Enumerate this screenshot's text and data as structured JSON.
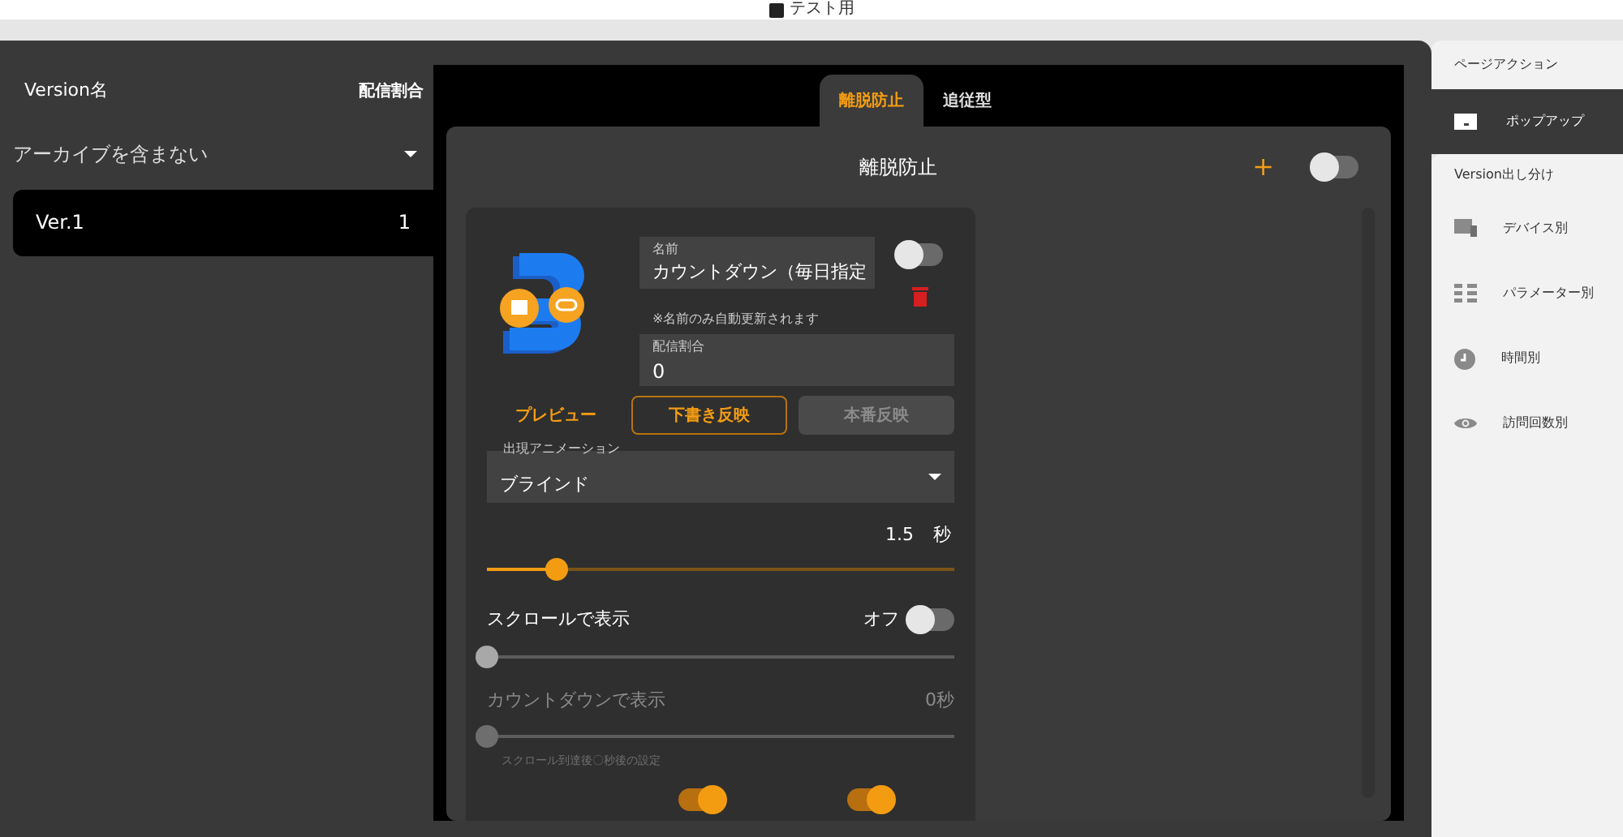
{
  "header": {
    "label": "テスト用"
  },
  "versions": {
    "col_name": "Version名",
    "col_ratio": "配信割合",
    "filter": "アーカイブを含まない",
    "items": [
      {
        "name": "Ver.1",
        "ratio": "1",
        "selected": true
      }
    ]
  },
  "tabs": [
    {
      "label": "離脱防止",
      "selected": true
    },
    {
      "label": "追従型",
      "selected": false
    }
  ],
  "panel": {
    "title": "離脱防止",
    "add": "+",
    "on": false
  },
  "item": {
    "name_label": "名前",
    "name_value": "カウントダウン（毎日指定",
    "on": false,
    "note": "※名前のみ自動更新されます",
    "ratio_label": "配信割合",
    "ratio_value": "0",
    "preview": "プレビュー",
    "draft": "下書き反映",
    "publish": {
      "label": "本番反映",
      "disabled": true
    },
    "animation_label": "出現アニメーション",
    "animation_value": "ブラインド",
    "duration": "1.5",
    "duration_unit": "秒",
    "duration_slider": {
      "level": 0.15
    },
    "scroll": {
      "label": "スクロールで表示",
      "state_label": "オフ",
      "on": false,
      "level": 0
    },
    "countdown": {
      "label": "カウントダウンで表示",
      "value": "0秒",
      "level": 0,
      "disabled": true,
      "hint": "スクロール到達後〇秒後の設定"
    },
    "bottom_toggles": [
      {
        "on": true
      },
      {
        "on": true
      }
    ]
  },
  "sidebar": [
    {
      "title": "ページアクション",
      "items": [
        {
          "label": "ポップアップ",
          "kind": "popup",
          "selected": true
        }
      ]
    },
    {
      "title": "Version出し分け",
      "items": [
        {
          "label": "デバイス別",
          "kind": "device",
          "selected": false
        },
        {
          "label": "パラメーター別",
          "kind": "params",
          "selected": false
        },
        {
          "label": "時間別",
          "kind": "clock",
          "selected": false
        },
        {
          "label": "訪問回数別",
          "kind": "eye",
          "selected": false
        }
      ]
    }
  ]
}
